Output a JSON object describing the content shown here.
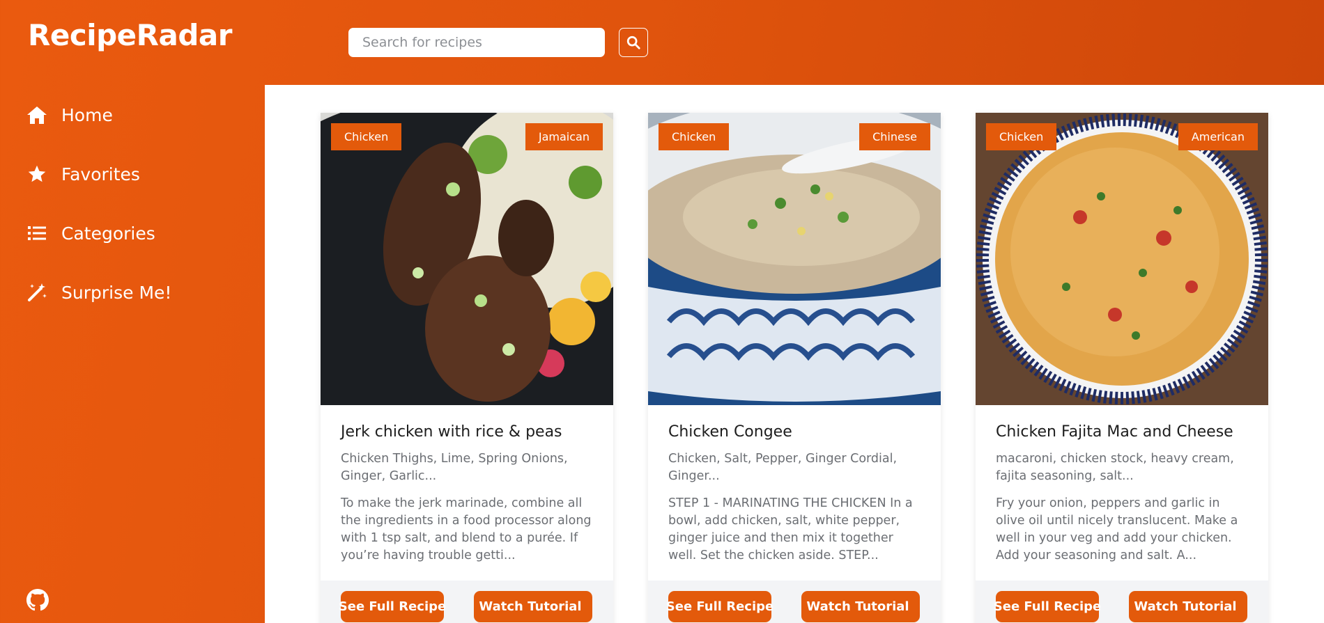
{
  "app": {
    "title": "RecipeRadar"
  },
  "search": {
    "placeholder": "Search for recipes",
    "button_icon": "search-icon"
  },
  "sidebar": {
    "items": [
      {
        "label": "Home",
        "icon": "home-icon"
      },
      {
        "label": "Favorites",
        "icon": "star-icon"
      },
      {
        "label": "Categories",
        "icon": "list-icon"
      },
      {
        "label": "Surprise Me!",
        "icon": "magic-wand-icon"
      }
    ],
    "footer_icon": "github-icon"
  },
  "colors": {
    "accent": "#e35a0b",
    "sidebar": "#e0540d",
    "card_footer": "#f3f4f6"
  },
  "recipes": [
    {
      "category": "Chicken",
      "area": "Jamaican",
      "title": "Jerk chicken with rice & peas",
      "ingredients": "Chicken Thighs, Lime, Spring Onions, Ginger, Garlic...",
      "description": "To make the jerk marinade, combine all the ingredients in a food processor along with 1 tsp salt, and blend to a purée. If you’re having trouble getti...",
      "full_label": "See Full Recipe",
      "watch_label": "Watch Tutorial"
    },
    {
      "category": "Chicken",
      "area": "Chinese",
      "title": "Chicken Congee",
      "ingredients": "Chicken, Salt, Pepper, Ginger Cordial, Ginger...",
      "description": "STEP 1 - MARINATING THE CHICKEN In a bowl, add chicken, salt, white pepper, ginger juice and then mix it together well. Set the chicken aside. STEP...",
      "full_label": "See Full Recipe",
      "watch_label": "Watch Tutorial"
    },
    {
      "category": "Chicken",
      "area": "American",
      "title": "Chicken Fajita Mac and Cheese",
      "ingredients": "macaroni, chicken stock, heavy cream, fajita seasoning, salt...",
      "description": "Fry your onion, peppers and garlic in olive oil until nicely translucent. Make a well in your veg and add your chicken. Add your seasoning and salt. A...",
      "full_label": "See Full Recipe",
      "watch_label": "Watch Tutorial"
    }
  ]
}
